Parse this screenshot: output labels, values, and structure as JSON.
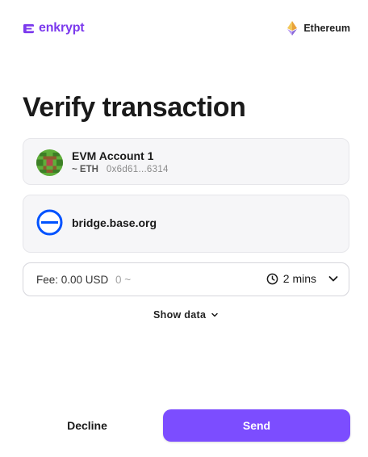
{
  "app": {
    "logo_text": "enkrypt",
    "logo_icon": "enkrypt-logo-icon",
    "brand_color": "#7c3aed"
  },
  "network": {
    "name": "Ethereum",
    "icon": "ethereum-icon"
  },
  "page": {
    "title": "Verify transaction"
  },
  "account": {
    "name": "EVM Account 1",
    "balance": "~ ETH",
    "address": "0x6d61...6314",
    "avatar_icon": "pixel-identicon-avatar"
  },
  "site": {
    "domain": "bridge.base.org",
    "icon": "base-logo-icon"
  },
  "fee": {
    "label": "Fee: 0.00 USD",
    "alt_value": "0 ~",
    "time": "2 mins",
    "clock_icon": "clock-icon",
    "dropdown_icon": "chevron-down-icon"
  },
  "show_data": {
    "label": "Show data",
    "icon": "chevron-down-icon"
  },
  "actions": {
    "decline_label": "Decline",
    "send_label": "Send",
    "send_color": "#7c4dff"
  }
}
